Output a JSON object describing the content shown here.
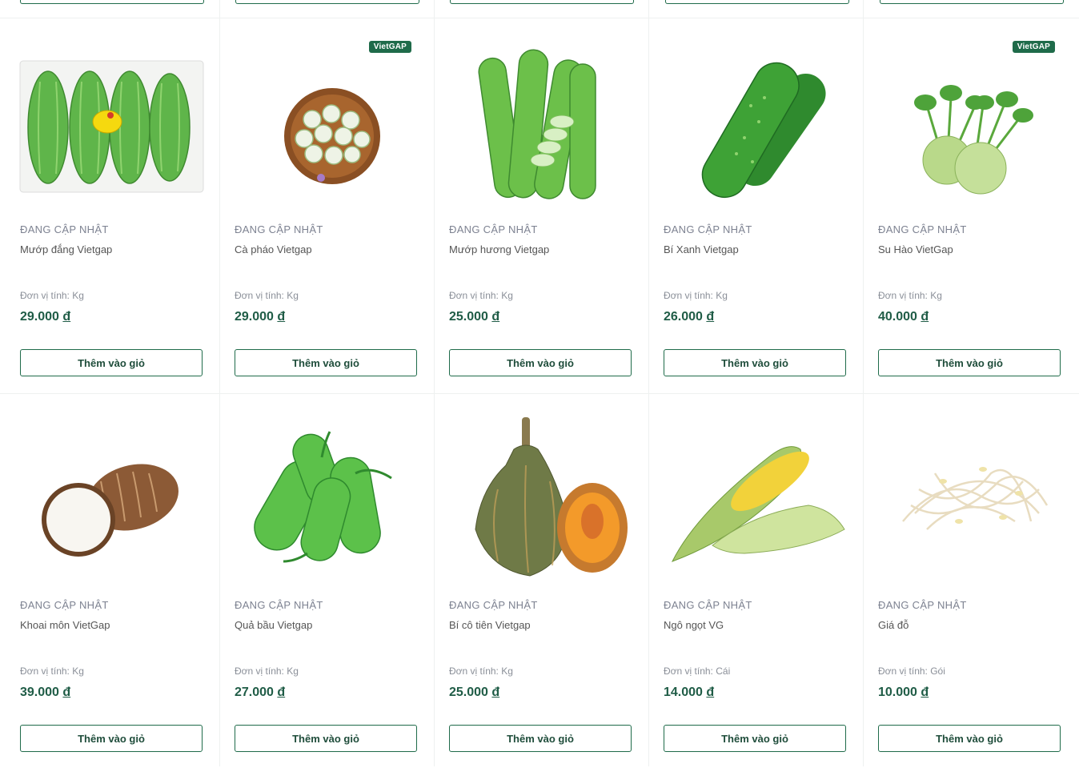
{
  "badge_label": "VietGAP",
  "add_to_cart_label": "Thêm vào giỏ",
  "colors": {
    "brand_green": "#1f6b4a",
    "price_green": "#1f5c46",
    "status_grey": "#7d8291"
  },
  "products": [
    {
      "status": "ĐANG CẬP NHẬT",
      "name": "Mướp đắng Vietgap",
      "unit": "Đơn vị tính: Kg",
      "price": "29.000",
      "currency": "đ",
      "badge": false,
      "icon": "bitter-melon-image"
    },
    {
      "status": "ĐANG CẬP NHẬT",
      "name": "Cà pháo Vietgap",
      "unit": "Đơn vị tính: Kg",
      "price": "29.000",
      "currency": "đ",
      "badge": true,
      "icon": "eggplant-basket-image"
    },
    {
      "status": "ĐANG CẬP NHẬT",
      "name": "Mướp hương Vietgap",
      "unit": "Đơn vị tính: Kg",
      "price": "25.000",
      "currency": "đ",
      "badge": false,
      "icon": "luffa-image"
    },
    {
      "status": "ĐANG CẬP NHẬT",
      "name": "Bí Xanh Vietgap",
      "unit": "Đơn vị tính: Kg",
      "price": "26.000",
      "currency": "đ",
      "badge": false,
      "icon": "winter-melon-image"
    },
    {
      "status": "ĐANG CẬP NHẬT",
      "name": "Su Hào VietGap",
      "unit": "Đơn vị tính: Kg",
      "price": "40.000",
      "currency": "đ",
      "badge": true,
      "icon": "kohlrabi-image"
    },
    {
      "status": "ĐANG CẬP NHẬT",
      "name": "Khoai môn VietGap",
      "unit": "Đơn vị tính: Kg",
      "price": "39.000",
      "currency": "đ",
      "badge": false,
      "icon": "taro-image"
    },
    {
      "status": "ĐANG CẬP NHẬT",
      "name": "Quả bầu Vietgap",
      "unit": "Đơn vị tính: Kg",
      "price": "27.000",
      "currency": "đ",
      "badge": false,
      "icon": "bottle-gourd-image"
    },
    {
      "status": "ĐANG CẬP NHẬT",
      "name": "Bí cô tiên Vietgap",
      "unit": "Đơn vị tính: Kg",
      "price": "25.000",
      "currency": "đ",
      "badge": false,
      "icon": "pumpkin-image"
    },
    {
      "status": "ĐANG CẬP NHẬT",
      "name": "Ngô ngọt VG",
      "unit": "Đơn vị tính: Cái",
      "price": "14.000",
      "currency": "đ",
      "badge": false,
      "icon": "corn-image"
    },
    {
      "status": "ĐANG CẬP NHẬT",
      "name": "Giá đỗ",
      "unit": "Đơn vị tính: Gói",
      "price": "10.000",
      "currency": "đ",
      "badge": false,
      "icon": "bean-sprouts-image"
    }
  ]
}
